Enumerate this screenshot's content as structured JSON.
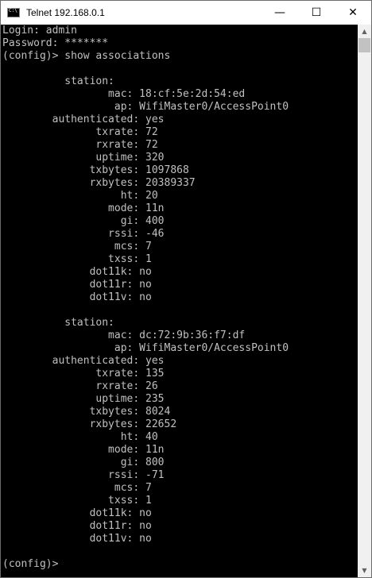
{
  "window": {
    "title": "Telnet 192.168.0.1",
    "minimize": "—",
    "maximize": "☐",
    "close": "✕"
  },
  "scrollbar": {
    "up": "▲",
    "down": "▼"
  },
  "console": {
    "text": "Login: admin\nPassword: *******\n(config)> show associations\n\n          station:\n                 mac: 18:cf:5e:2d:54:ed\n                  ap: WifiMaster0/AccessPoint0\n        authenticated: yes\n               txrate: 72\n               rxrate: 72\n               uptime: 320\n              txbytes: 1097868\n              rxbytes: 20389337\n                   ht: 20\n                 mode: 11n\n                   gi: 400\n                 rssi: -46\n                  mcs: 7\n                 txss: 1\n              dot11k: no\n              dot11r: no\n              dot11v: no\n\n          station:\n                 mac: dc:72:9b:36:f7:df\n                  ap: WifiMaster0/AccessPoint0\n        authenticated: yes\n               txrate: 135\n               rxrate: 26\n               uptime: 235\n              txbytes: 8024\n              rxbytes: 22652\n                   ht: 40\n                 mode: 11n\n                   gi: 800\n                 rssi: -71\n                  mcs: 7\n                 txss: 1\n              dot11k: no\n              dot11r: no\n              dot11v: no\n\n(config)>"
  }
}
